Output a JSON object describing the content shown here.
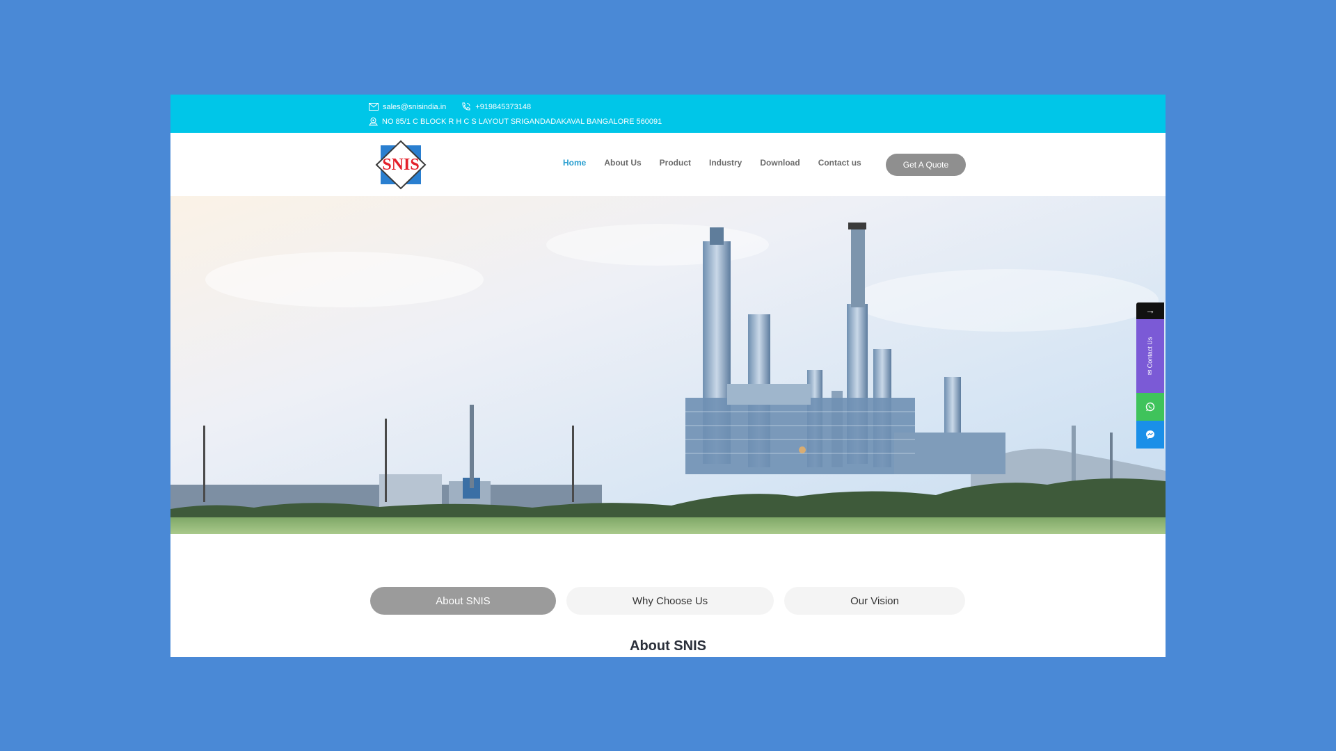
{
  "topbar": {
    "email": "sales@snisindia.in",
    "phone": "+919845373148",
    "address": "NO 85/1 C BLOCK R H C S LAYOUT SRIGANDADAKAVAL BANGALORE 560091"
  },
  "header": {
    "logo_text": "SNIS",
    "nav": [
      {
        "label": "Home",
        "active": true
      },
      {
        "label": "About Us",
        "active": false
      },
      {
        "label": "Product",
        "active": false
      },
      {
        "label": "Industry",
        "active": false
      },
      {
        "label": "Download",
        "active": false
      },
      {
        "label": "Contact us",
        "active": false
      }
    ],
    "quote_button": "Get A Quote"
  },
  "side_widget": {
    "arrow": "→",
    "contact_label": "✉ Contact Us",
    "whatsapp_icon": "whatsapp-icon",
    "messenger_icon": "messenger-icon"
  },
  "tabs": [
    {
      "label": "About SNIS",
      "active": true
    },
    {
      "label": "Why Choose Us",
      "active": false
    },
    {
      "label": "Our Vision",
      "active": false
    }
  ],
  "section_title": "About SNIS",
  "colors": {
    "page_bg": "#4a89d6",
    "topbar": "#00c6e8",
    "nav_active": "#2a9fd0",
    "quote_btn": "#8f8f8f",
    "contact_widget": "#7b5ad6",
    "whatsapp": "#3fc35b",
    "messenger": "#1a8fe8"
  }
}
